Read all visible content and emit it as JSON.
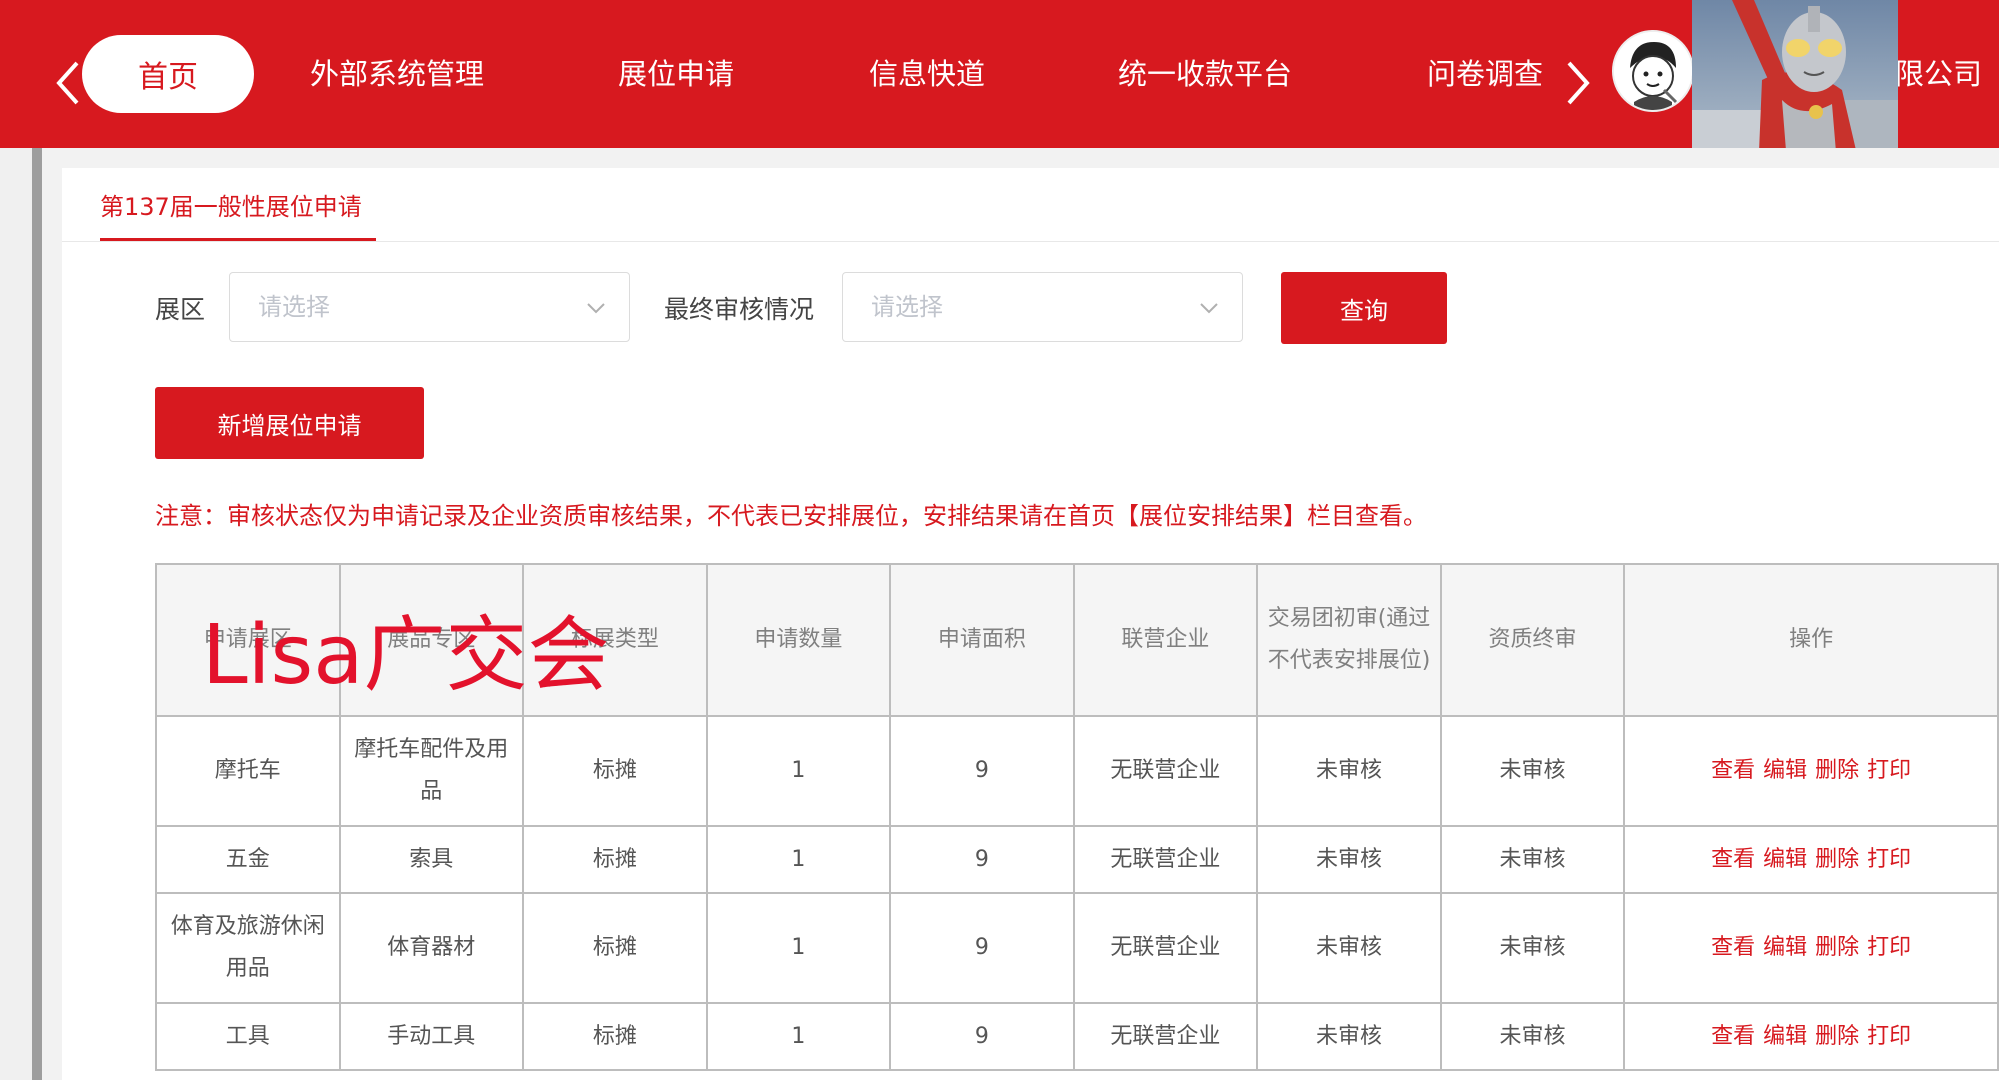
{
  "nav": {
    "items": [
      {
        "label": "首页",
        "active": true
      },
      {
        "label": "外部系统管理"
      },
      {
        "label": "展位申请"
      },
      {
        "label": "信息快道"
      },
      {
        "label": "统一收款平台"
      },
      {
        "label": "问卷调查"
      }
    ],
    "company_fragment": "有限公司",
    "prev_icon": "chevron-left-icon",
    "next_icon": "chevron-right-icon"
  },
  "tab": {
    "label": "第137届一般性展位申请"
  },
  "filters": {
    "zone_label": "展区",
    "zone_placeholder": "请选择",
    "review_label": "最终审核情况",
    "review_placeholder": "请选择",
    "query_label": "查询"
  },
  "add_button_label": "新增展位申请",
  "notice": "注意：审核状态仅为申请记录及企业资质审核结果，不代表已安排展位，安排结果请在首页【展位安排结果】栏目查看。",
  "watermark": "Lisa广交会",
  "table": {
    "headers": [
      "申请展区",
      "展品专区",
      "标展类型",
      "申请数量",
      "申请面积",
      "联营企业",
      "交易团初审(通过不代表安排展位)",
      "资质终审",
      "操作"
    ],
    "rows": [
      [
        "摩托车",
        "摩托车配件及用品",
        "标摊",
        "1",
        "9",
        "无联营企业",
        "未审核",
        "未审核"
      ],
      [
        "五金",
        "索具",
        "标摊",
        "1",
        "9",
        "无联营企业",
        "未审核",
        "未审核"
      ],
      [
        "体育及旅游休闲用品",
        "体育器材",
        "标摊",
        "1",
        "9",
        "无联营企业",
        "未审核",
        "未审核"
      ],
      [
        "工具",
        "手动工具",
        "标摊",
        "1",
        "9",
        "无联营企业",
        "未审核",
        "未审核"
      ]
    ],
    "actions": [
      "查看",
      "编辑",
      "删除",
      "打印"
    ]
  },
  "colors": {
    "brand_red": "#d7191f",
    "watermark_red": "#e3122c"
  }
}
